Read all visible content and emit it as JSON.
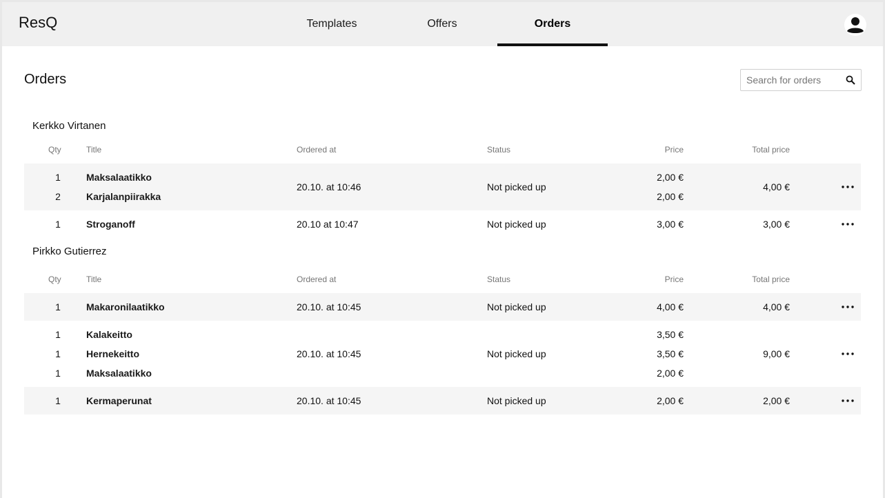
{
  "app": {
    "brand": "ResQ"
  },
  "nav": {
    "tabs": [
      {
        "label": "Templates",
        "active": false
      },
      {
        "label": "Offers",
        "active": false
      },
      {
        "label": "Orders",
        "active": true
      }
    ]
  },
  "page": {
    "title": "Orders"
  },
  "search": {
    "placeholder": "Search for orders",
    "value": ""
  },
  "columns": {
    "qty": "Qty",
    "title": "Title",
    "ordered_at": "Ordered at",
    "status": "Status",
    "price": "Price",
    "total_price": "Total price"
  },
  "customers": [
    {
      "name": "Kerkko Virtanen",
      "orders": [
        {
          "items": [
            {
              "qty": "1",
              "title": "Maksalaatikko",
              "price": "2,00 €"
            },
            {
              "qty": "2",
              "title": "Karjalanpiirakka",
              "price": "2,00 €"
            }
          ],
          "ordered_at": "20.10. at 10:46",
          "status": "Not picked up",
          "total": "4,00 €"
        },
        {
          "items": [
            {
              "qty": "1",
              "title": "Stroganoff",
              "price": "3,00 €"
            }
          ],
          "ordered_at": "20.10 at 10:47",
          "status": "Not picked up",
          "total": "3,00 €"
        }
      ]
    },
    {
      "name": "Pirkko Gutierrez",
      "orders": [
        {
          "items": [
            {
              "qty": "1",
              "title": "Makaronilaatikko",
              "price": "4,00 €"
            }
          ],
          "ordered_at": "20.10. at 10:45",
          "status": "Not picked up",
          "total": "4,00 €"
        },
        {
          "items": [
            {
              "qty": "1",
              "title": "Kalakeitto",
              "price": "3,50 €"
            },
            {
              "qty": "1",
              "title": "Hernekeitto",
              "price": "3,50 €"
            },
            {
              "qty": "1",
              "title": "Maksalaatikko",
              "price": "2,00 €"
            }
          ],
          "ordered_at": "20.10. at 10:45",
          "status": "Not picked up",
          "total": "9,00 €"
        },
        {
          "items": [
            {
              "qty": "1",
              "title": "Kermaperunat",
              "price": "2,00 €"
            }
          ],
          "ordered_at": "20.10. at 10:45",
          "status": "Not picked up",
          "total": "2,00 €"
        }
      ]
    }
  ]
}
